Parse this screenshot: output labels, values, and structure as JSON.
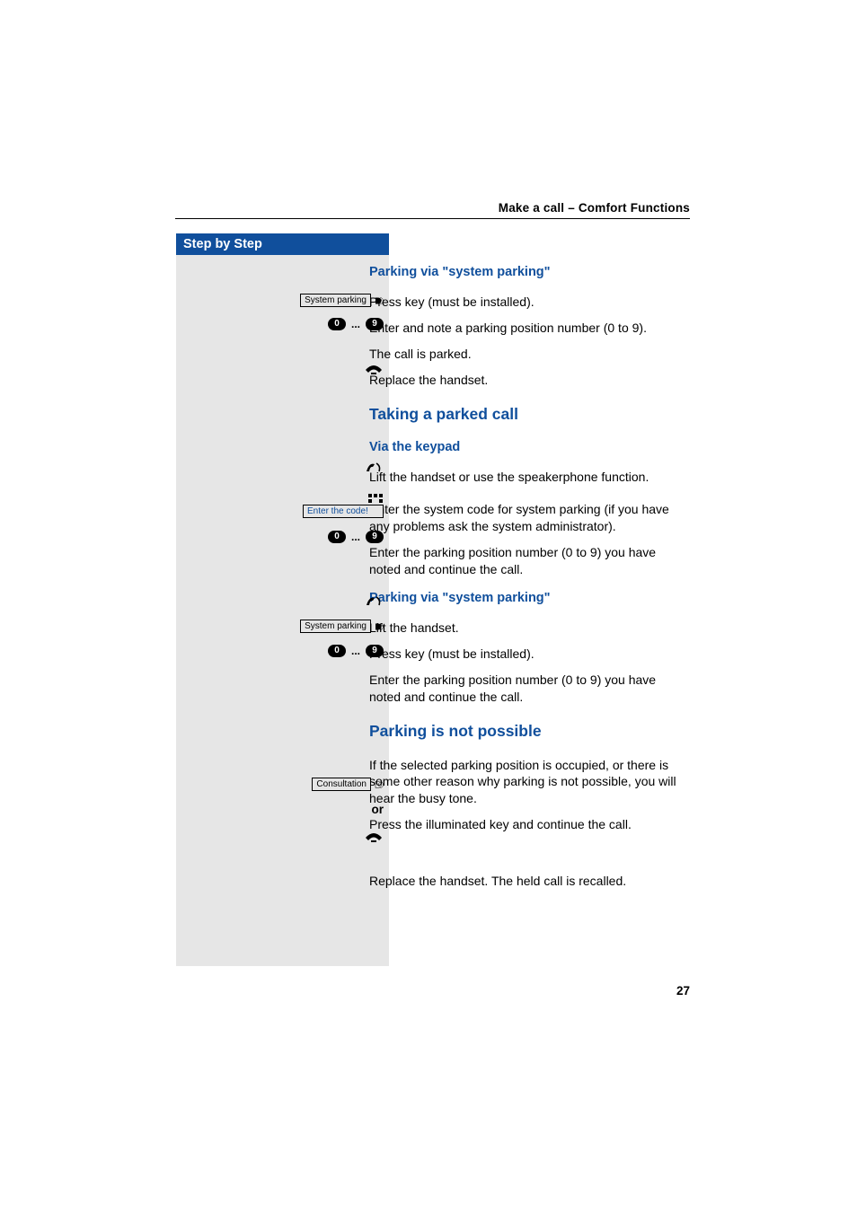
{
  "header": {
    "running_title": "Make a call – Comfort Functions"
  },
  "sidebar": {
    "title": "Step by Step",
    "key_labels": {
      "system_parking": "System parking",
      "consultation": "Consultation",
      "enter_code": "Enter the code!"
    },
    "digits": {
      "zero": "0",
      "nine": "9",
      "range_sep": "..."
    },
    "or_label": "or"
  },
  "content": {
    "s1_heading": "Parking via \"system parking\"",
    "s1_p1": "Press key (must be installed).",
    "s1_p2": "Enter and note a parking position number (0 to 9).",
    "s1_p3": "The call is parked.",
    "s1_p4": "Replace the handset.",
    "s2_heading": "Taking a parked call",
    "s2_sub1": "Via the keypad",
    "s2_p1": "Lift the handset or use the speakerphone function.",
    "s2_p2": "Enter the system code for system parking (if you have any problems ask the system administrator).",
    "s2_p3": "Enter the parking position number (0 to 9) you have noted and continue the call.",
    "s2_sub2": "Parking via \"system parking\"",
    "s2_p4": "Lift the handset.",
    "s2_p5": "Press key (must be installed).",
    "s2_p6": "Enter the parking position number (0 to 9) you have noted and continue the call.",
    "s3_heading": "Parking is not possible",
    "s3_p1": "If the selected parking position is occupied, or there is some other reason why parking is not possible, you will hear the busy tone.",
    "s3_p2": "Press the illuminated key and continue the call.",
    "s3_p3": "Replace the handset. The held call is recalled."
  },
  "page_number": "27"
}
